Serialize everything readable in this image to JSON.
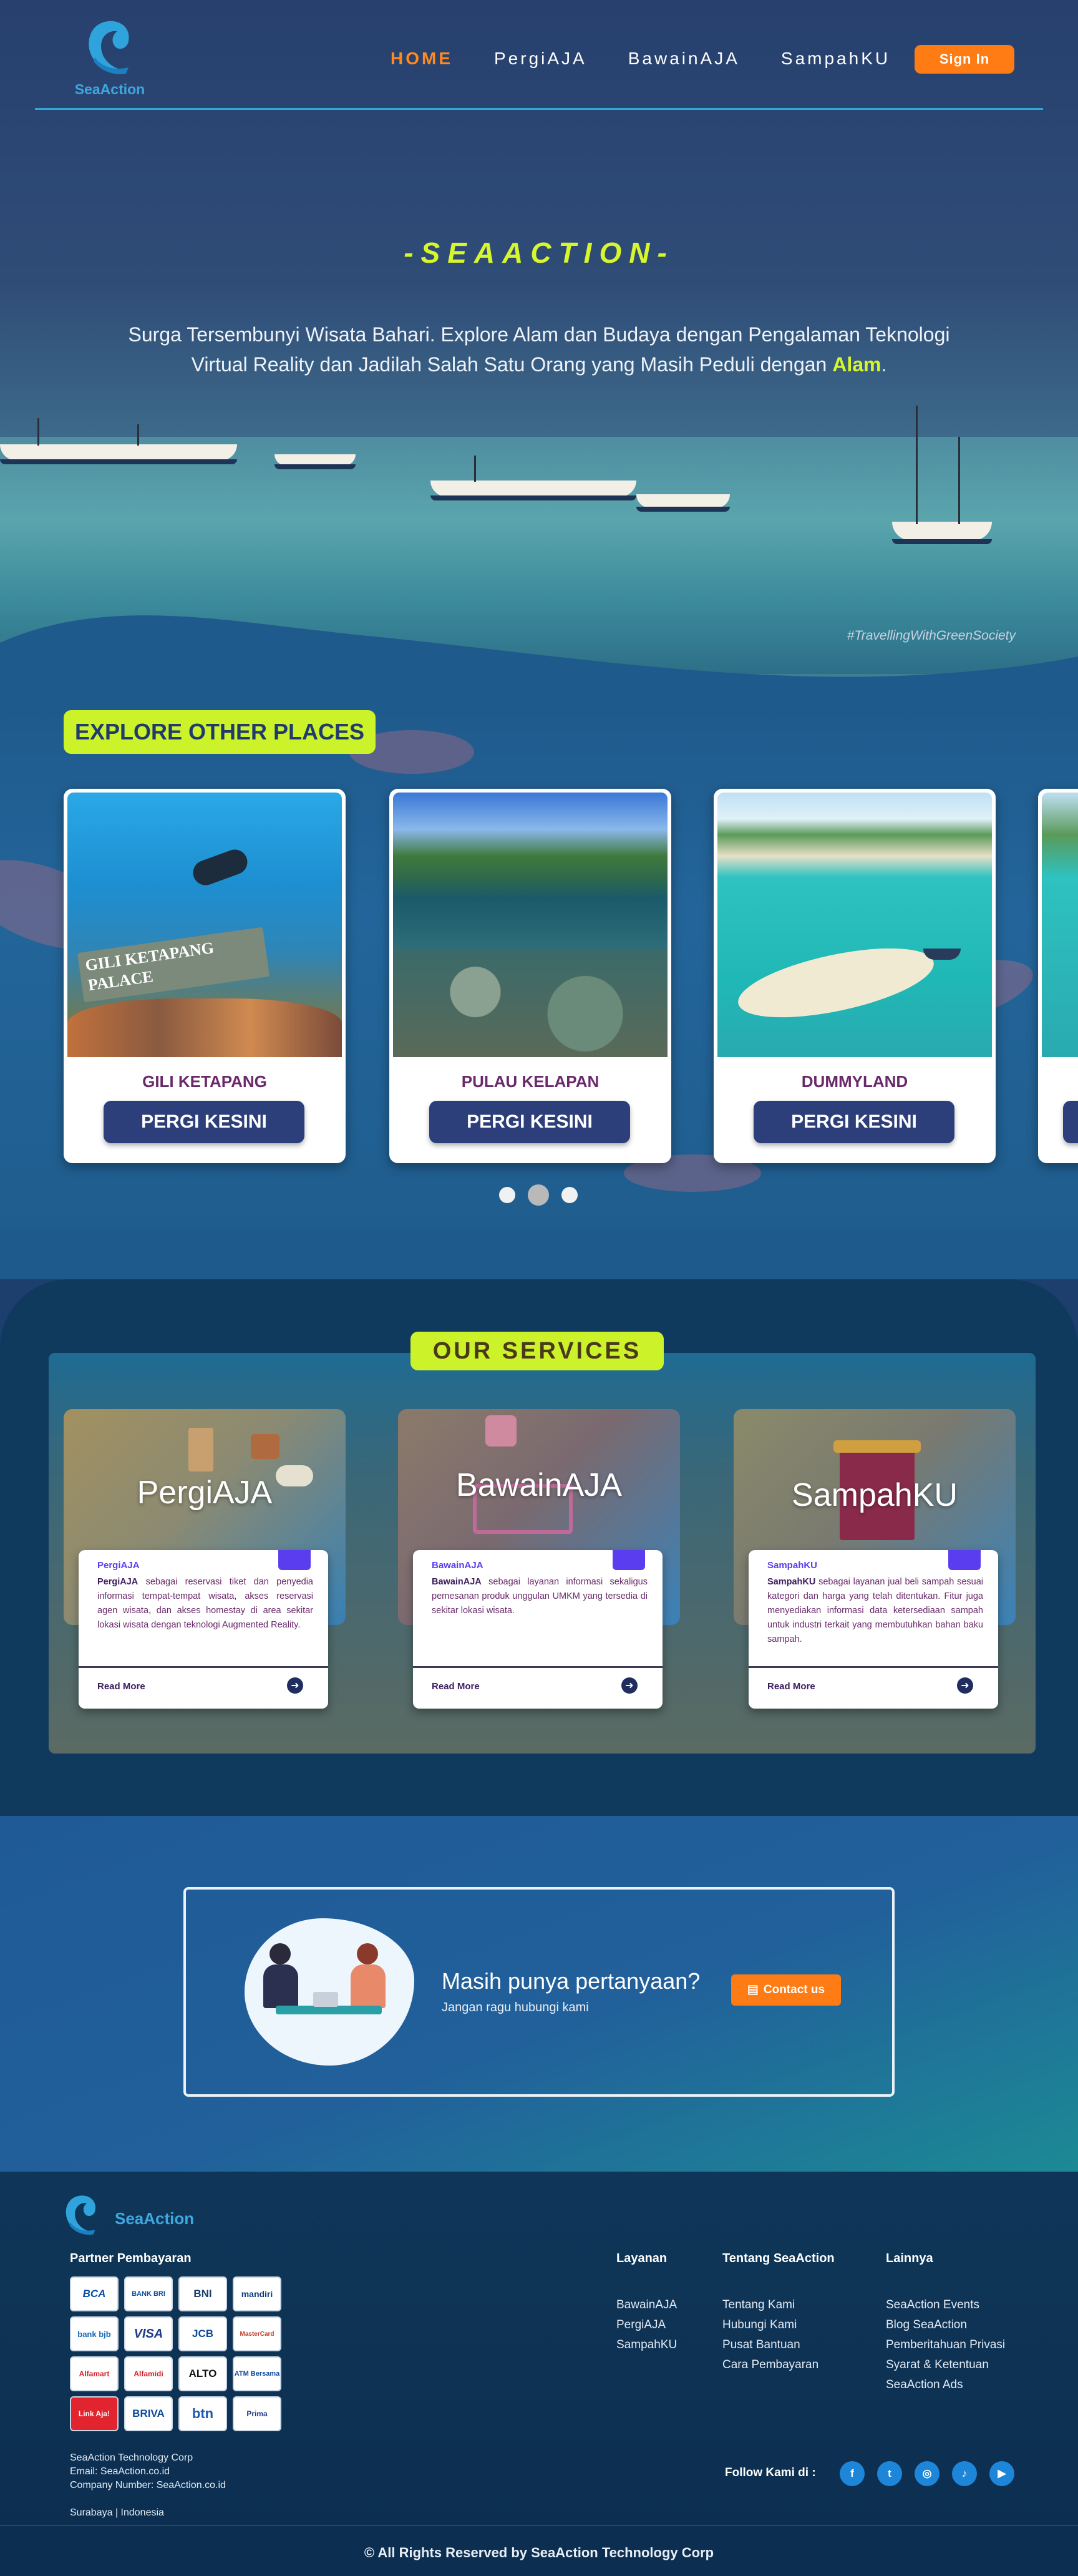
{
  "brand": {
    "name": "SeaAction"
  },
  "nav": {
    "items": [
      {
        "label": "HOME"
      },
      {
        "label": "PergiAJA"
      },
      {
        "label": "BawainAJA"
      },
      {
        "label": "SampahKU"
      }
    ],
    "signin_label": "Sign In"
  },
  "hero": {
    "title": "-SEAACTION-",
    "text": "Surga Tersembunyi Wisata Bahari. Explore Alam dan Budaya dengan Pengalaman Teknologi Virtual Reality dan Jadilah Salah Satu Orang yang Masih Peduli dengan",
    "highlight": "Alam",
    "text_end": ".",
    "hashtag": "#TravellingWithGreenSociety"
  },
  "explore": {
    "heading": "EXPLORE OTHER PLACES",
    "button_label": "PERGI KESINI",
    "places": [
      {
        "name": "GILI KETAPANG",
        "sign_text": "GILI KETAPANG PALACE"
      },
      {
        "name": "PULAU KELAPAN"
      },
      {
        "name": "DUMMYLAND"
      }
    ],
    "carousel_active_index": 1
  },
  "services": {
    "heading": "OUR SERVICES",
    "read_more": "Read More",
    "cards": [
      {
        "title": "PergiAJA",
        "small": "PergiAJA",
        "bold": "PergiAJA",
        "desc": "sebagai reservasi tiket dan penyedia informasi tempat-tempat wisata, akses reservasi agen wisata, dan akses homestay di area sekitar lokasi wisata dengan teknologi Augmented Reality."
      },
      {
        "title": "BawainAJA",
        "small": "BawainAJA",
        "bold": "BawainAJA",
        "desc": "sebagai layanan informasi sekaligus pemesanan produk unggulan UMKM yang tersedia di sekitar lokasi wisata."
      },
      {
        "title": "SampahKU",
        "small": "SampahKU",
        "bold": "SampahKU",
        "desc": "sebagai layanan jual beli sampah sesuai kategori dan harga yang telah ditentukan. Fitur juga menyediakan informasi data ketersediaan sampah untuk industri terkait yang membutuhkan bahan baku sampah."
      }
    ]
  },
  "contact": {
    "question": "Masih punya pertanyaan?",
    "sub": "Jangan ragu hubungi kami",
    "button_label": "Contact us"
  },
  "footer": {
    "partner_title": "Partner Pembayaran",
    "payments": [
      "BCA",
      "BANK BRI",
      "BNI",
      "mandiri",
      "bank bjb",
      "VISA",
      "JCB",
      "MasterCard",
      "Alfamart",
      "Alfamidi",
      "ALTO",
      "ATM Bersama",
      "Link Aja!",
      "BRIVA",
      "btn",
      "Prima"
    ],
    "company": {
      "name": "SeaAction Technology Corp",
      "email": "Email: SeaAction.co.id",
      "number": "Company Number: SeaAction.co.id",
      "location": "Surabaya | Indonesia"
    },
    "columns": [
      {
        "title": "Layanan",
        "items": [
          "BawainAJA",
          "PergiAJA",
          "SampahKU"
        ]
      },
      {
        "title": "Tentang SeaAction",
        "items": [
          "Tentang Kami",
          "Hubungi Kami",
          "Pusat Bantuan",
          "Cara Pembayaran"
        ]
      },
      {
        "title": "Lainnya",
        "items": [
          "SeaAction Events",
          "Blog SeaAction",
          "Pemberitahuan Privasi",
          "Syarat & Ketentuan",
          "SeaAction Ads"
        ]
      }
    ],
    "follow_label": "Follow Kami di :",
    "socials": [
      {
        "icon": "facebook-icon",
        "glyph": "f"
      },
      {
        "icon": "twitter-icon",
        "glyph": "t"
      },
      {
        "icon": "instagram-icon",
        "glyph": "◎"
      },
      {
        "icon": "tiktok-icon",
        "glyph": "♪"
      },
      {
        "icon": "youtube-icon",
        "glyph": "▶"
      }
    ],
    "copyright": "© All Rights Reserved by SeaAction Technology Corp"
  },
  "colors": {
    "accent_orange": "#ff7b14",
    "accent_lime": "#ccf22a",
    "brand_blue": "#3ea7e0",
    "navy": "#2c3f7a"
  }
}
